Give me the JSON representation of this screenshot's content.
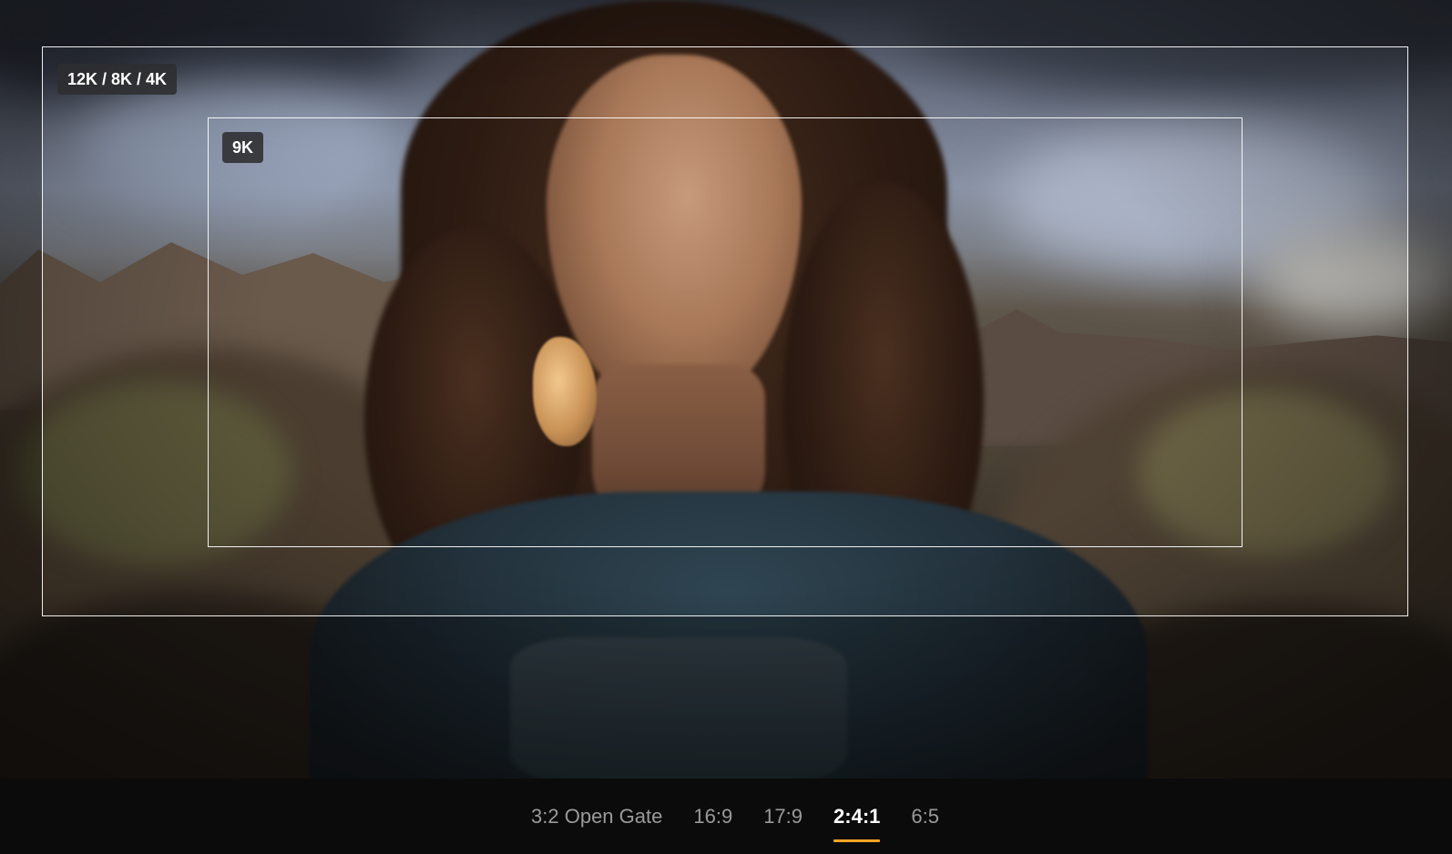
{
  "frames": {
    "outer_label": "12K / 8K / 4K",
    "inner_label": "9K"
  },
  "aspect_tabs": [
    {
      "label": "3:2 Open Gate",
      "active": false
    },
    {
      "label": "16:9",
      "active": false
    },
    {
      "label": "17:9",
      "active": false
    },
    {
      "label": "2:4:1",
      "active": true
    },
    {
      "label": "6:5",
      "active": false
    }
  ],
  "colors": {
    "active_underline": "#f5a623",
    "bar_background": "#0b0b0b",
    "inactive_tab_text": "#9a9a9a",
    "active_tab_text": "#ffffff"
  }
}
